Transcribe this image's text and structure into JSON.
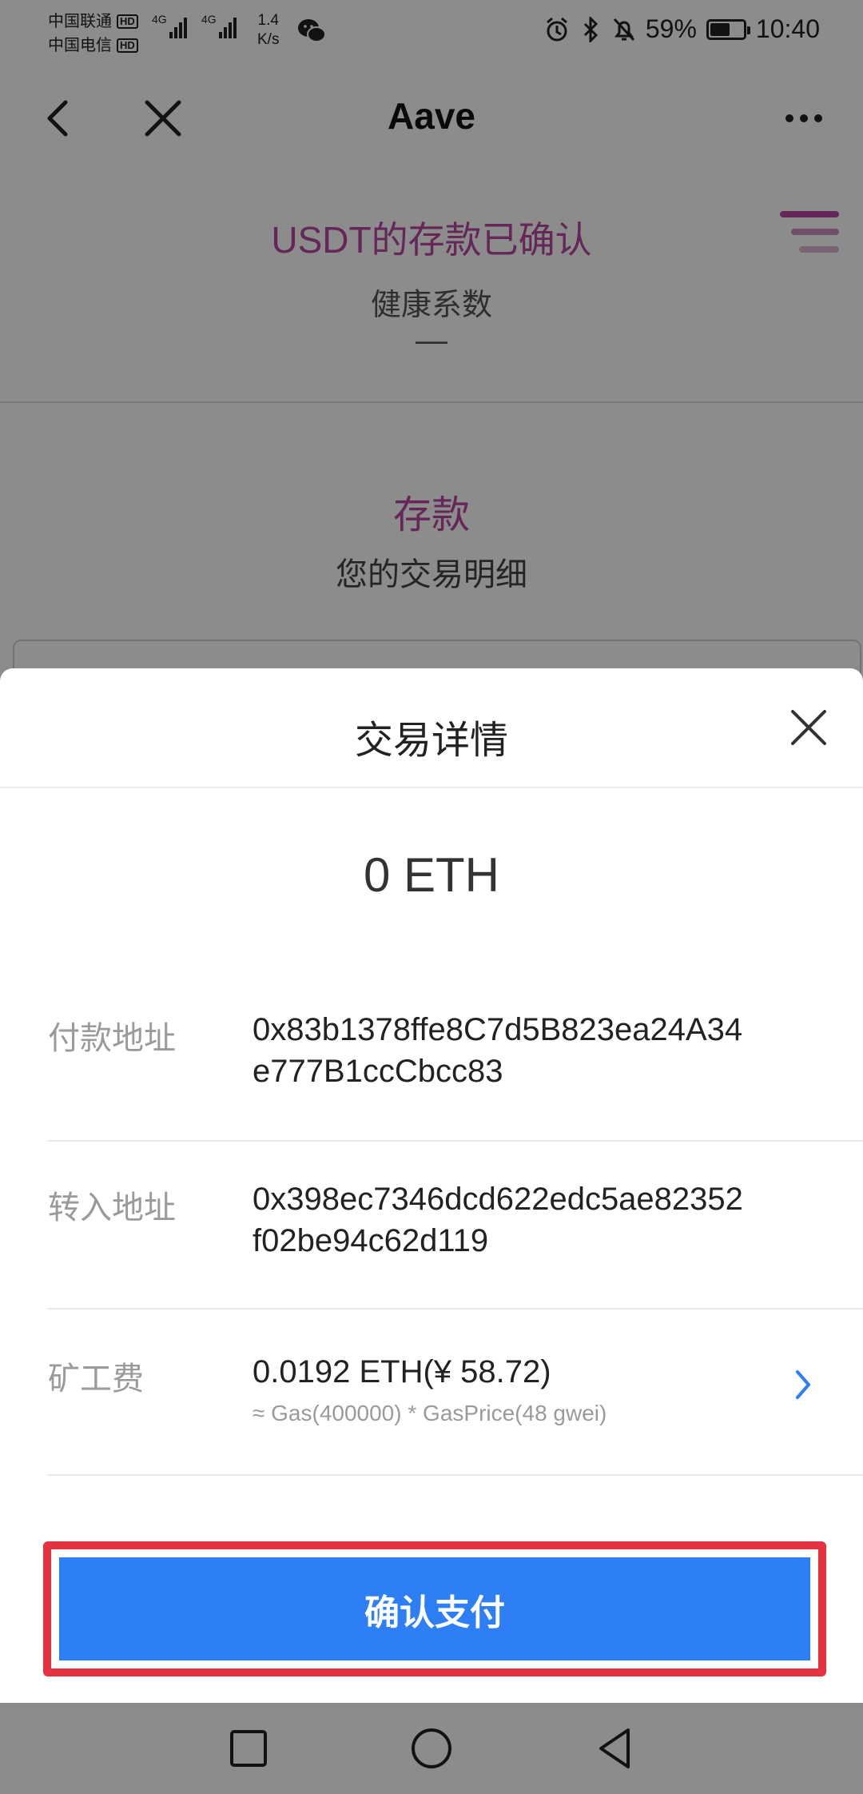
{
  "status_bar": {
    "carrier_1": "中国联通",
    "carrier_2": "中国电信",
    "hd": "HD",
    "net_1": "4G",
    "net_2": "4G",
    "speed_value": "1.4",
    "speed_unit": "K/s",
    "battery_text": "59%",
    "battery_level": 0.59,
    "time": "10:40"
  },
  "navbar": {
    "title": "Aave"
  },
  "subheader": {
    "title": "USDT的存款已确认"
  },
  "background": {
    "health_label": "健康系数",
    "health_value": "—",
    "deposit_title": "存款",
    "deposit_subtitle": "您的交易明细"
  },
  "sheet": {
    "title": "交易详情",
    "amount": "0 ETH",
    "rows": [
      {
        "label": "付款地址",
        "value_line1": "0x83b1378ffe8C7d5B823ea24A34",
        "value_line2": "e777B1ccCbcc83"
      },
      {
        "label": "转入地址",
        "value_line1": "0x398ec7346dcd622edc5ae82352",
        "value_line2": "f02be94c62d119"
      },
      {
        "label": "矿工费",
        "value": "0.0192 ETH(¥ 58.72)",
        "sub": "≈ Gas(400000) * GasPrice(48 gwei)"
      }
    ],
    "confirm_button": "确认支付"
  },
  "colors": {
    "accent_purple": "#b6479f",
    "button_blue": "#2e7ef5",
    "highlight_red": "#e53240",
    "chevron_blue": "#2e7ef5"
  }
}
